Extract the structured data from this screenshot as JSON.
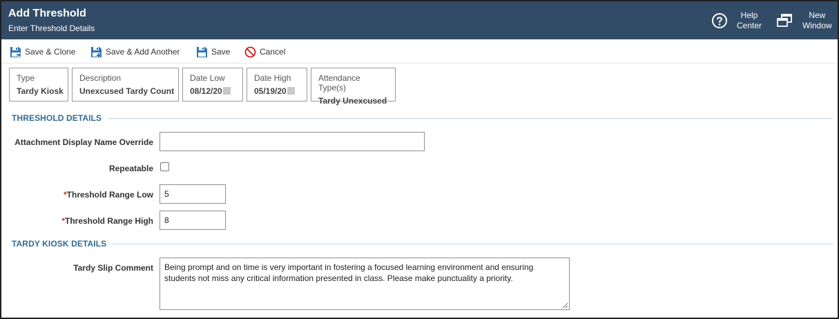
{
  "header": {
    "title": "Add Threshold",
    "subtitle": "Enter Threshold Details",
    "help_label_1": "Help",
    "help_label_2": "Center",
    "newwin_label_1": "New",
    "newwin_label_2": "Window",
    "bg_color": "#324b66"
  },
  "toolbar": {
    "save_clone": "Save & Clone",
    "save_add": "Save & Add Another",
    "save": "Save",
    "cancel": "Cancel"
  },
  "summary": {
    "type_key": "Type",
    "type_val": "Tardy Kiosk",
    "desc_key": "Description",
    "desc_val": "Unexcused Tardy Count",
    "date_low_key": "Date Low",
    "date_low_val": "08/12/20",
    "date_high_key": "Date High",
    "date_high_val": "05/19/20",
    "att_key": "Attendance Type(s)",
    "att_val": "Tardy Unexcused"
  },
  "threshold": {
    "section_title": "THRESHOLD DETAILS",
    "attach_label": "Attachment Display Name Override",
    "attach_value": "",
    "repeatable_label": "Repeatable",
    "repeatable_checked": false,
    "req_mark": "*",
    "low_label": "Threshold Range Low",
    "low_value": "5",
    "high_label": "Threshold Range High",
    "high_value": "8"
  },
  "kiosk": {
    "section_title": "TARDY KIOSK DETAILS",
    "comment_label": "Tardy Slip Comment",
    "comment_value": "Being prompt and on time is very important in fostering a focused learning environment and ensuring students not miss any critical information presented in class. Please make punctuality a priority."
  },
  "icons": {
    "help": "help-circle-icon",
    "new_window": "new-window-icon",
    "save": "floppy-disk-icon",
    "cancel": "no-entry-icon"
  },
  "colors": {
    "section_title": "#2f6b96",
    "required": "#c0392b",
    "save_icon": "#2e74b5",
    "cancel_icon": "#cc1f1f"
  }
}
